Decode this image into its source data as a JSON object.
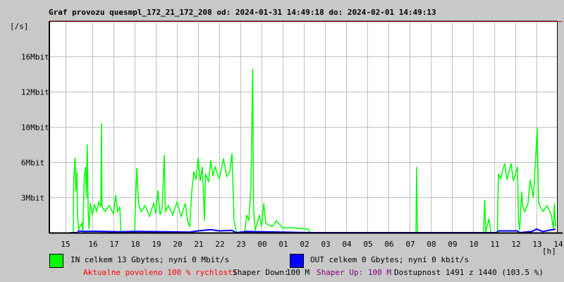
{
  "title": "Graf provozu quesmpl_172_21_172_208 od: 2024-01-31 14:49:18 do: 2024-02-01 14:49:13",
  "chart_data": {
    "type": "line",
    "title": "Graf provozu quesmpl_172_21_172_208 od: 2024-01-31 14:49:18 do: 2024-02-01 14:49:13",
    "ylabel": "[/s]",
    "xlabel": "[h]",
    "y_ticks": [
      {
        "v": 3,
        "label": "3Mbit"
      },
      {
        "v": 6,
        "label": "6Mbit"
      },
      {
        "v": 10,
        "label": "10Mbit"
      },
      {
        "v": 12,
        "label": "12Mbit"
      },
      {
        "v": 16,
        "label": "16Mbit"
      }
    ],
    "x_ticks": [
      {
        "h": 14.73,
        "label": "15"
      },
      {
        "h": 16,
        "label": "16"
      },
      {
        "h": 17,
        "label": "17"
      },
      {
        "h": 18,
        "label": "18"
      },
      {
        "h": 19,
        "label": "19"
      },
      {
        "h": 20,
        "label": "20"
      },
      {
        "h": 21,
        "label": "21"
      },
      {
        "h": 22,
        "label": "22"
      },
      {
        "h": 23,
        "label": "23"
      },
      {
        "h": 24,
        "label": "00"
      },
      {
        "h": 25,
        "label": "01"
      },
      {
        "h": 26,
        "label": "02"
      },
      {
        "h": 27,
        "label": "03"
      },
      {
        "h": 28,
        "label": "04"
      },
      {
        "h": 29,
        "label": "05"
      },
      {
        "h": 30,
        "label": "06"
      },
      {
        "h": 31,
        "label": "07"
      },
      {
        "h": 32,
        "label": "08"
      },
      {
        "h": 33,
        "label": "09"
      },
      {
        "h": 34,
        "label": "10"
      },
      {
        "h": 35,
        "label": "11"
      },
      {
        "h": 36,
        "label": "12"
      },
      {
        "h": 37,
        "label": "13"
      },
      {
        "h": 38,
        "label": "14"
      }
    ],
    "grid": true,
    "series": [
      {
        "name": "IN",
        "color": "#00ff00",
        "points": [
          [
            14.95,
            0
          ],
          [
            15.1,
            0
          ],
          [
            15.12,
            4.5
          ],
          [
            15.18,
            6.5
          ],
          [
            15.22,
            3.5
          ],
          [
            15.27,
            5.2
          ],
          [
            15.3,
            1.5
          ],
          [
            15.35,
            0.3
          ],
          [
            15.5,
            0.8
          ],
          [
            15.55,
            0.2
          ],
          [
            15.62,
            4.8
          ],
          [
            15.68,
            5.6
          ],
          [
            15.72,
            3
          ],
          [
            15.76,
            8
          ],
          [
            15.8,
            2
          ],
          [
            15.84,
            0.3
          ],
          [
            15.9,
            2.5
          ],
          [
            16.0,
            1.5
          ],
          [
            16.1,
            2.4
          ],
          [
            16.2,
            1.8
          ],
          [
            16.3,
            2.6
          ],
          [
            16.4,
            2.2
          ],
          [
            16.43,
            10.2
          ],
          [
            16.46,
            2.2
          ],
          [
            16.6,
            1.8
          ],
          [
            16.8,
            2.3
          ],
          [
            17.0,
            1.6
          ],
          [
            17.1,
            3.2
          ],
          [
            17.2,
            1.8
          ],
          [
            17.3,
            2.2
          ],
          [
            17.35,
            0
          ],
          [
            18.0,
            0
          ],
          [
            18.05,
            3
          ],
          [
            18.1,
            5.5
          ],
          [
            18.18,
            2.5
          ],
          [
            18.3,
            1.8
          ],
          [
            18.5,
            2.3
          ],
          [
            18.7,
            1.4
          ],
          [
            18.9,
            2.5
          ],
          [
            19.0,
            1.6
          ],
          [
            19.1,
            3.6
          ],
          [
            19.2,
            1.5
          ],
          [
            19.3,
            2.1
          ],
          [
            19.4,
            6.8
          ],
          [
            19.45,
            1.8
          ],
          [
            19.6,
            2.3
          ],
          [
            19.8,
            1.5
          ],
          [
            20.0,
            2.6
          ],
          [
            20.2,
            1.4
          ],
          [
            20.4,
            2.5
          ],
          [
            20.5,
            1.0
          ],
          [
            20.6,
            0.5
          ],
          [
            20.7,
            3.5
          ],
          [
            20.8,
            5.2
          ],
          [
            20.9,
            4.5
          ],
          [
            21.0,
            6.5
          ],
          [
            21.1,
            4.4
          ],
          [
            21.2,
            5.6
          ],
          [
            21.3,
            1.0
          ],
          [
            21.35,
            5.0
          ],
          [
            21.5,
            4.3
          ],
          [
            21.6,
            6.2
          ],
          [
            21.7,
            4.8
          ],
          [
            21.8,
            5.6
          ],
          [
            22.0,
            4.6
          ],
          [
            22.2,
            6.4
          ],
          [
            22.35,
            4.8
          ],
          [
            22.5,
            5.2
          ],
          [
            22.6,
            7.0
          ],
          [
            22.7,
            1.0
          ],
          [
            22.8,
            0.2
          ],
          [
            22.85,
            0
          ],
          [
            23.2,
            0
          ],
          [
            23.3,
            1.5
          ],
          [
            23.4,
            1.0
          ],
          [
            23.5,
            4
          ],
          [
            23.58,
            14.6
          ],
          [
            23.62,
            2
          ],
          [
            23.7,
            0.2
          ],
          [
            23.9,
            1.5
          ],
          [
            24.0,
            0.5
          ],
          [
            24.1,
            2.5
          ],
          [
            24.2,
            0.8
          ],
          [
            24.5,
            0.5
          ],
          [
            24.7,
            1.0
          ],
          [
            25.0,
            0.4
          ],
          [
            25.5,
            0.4
          ],
          [
            26.2,
            0.3
          ],
          [
            26.3,
            0
          ],
          [
            31.3,
            0
          ],
          [
            31.33,
            5.6
          ],
          [
            31.37,
            0
          ],
          [
            34.5,
            0
          ],
          [
            34.55,
            2.8
          ],
          [
            34.6,
            0
          ],
          [
            34.75,
            1.2
          ],
          [
            34.85,
            0
          ],
          [
            35.15,
            0
          ],
          [
            35.2,
            5.0
          ],
          [
            35.3,
            4.6
          ],
          [
            35.4,
            5.3
          ],
          [
            35.5,
            5.9
          ],
          [
            35.6,
            4.5
          ],
          [
            35.7,
            5.2
          ],
          [
            35.8,
            5.9
          ],
          [
            35.9,
            4.4
          ],
          [
            36.0,
            5.0
          ],
          [
            36.1,
            5.6
          ],
          [
            36.15,
            1.0
          ],
          [
            36.2,
            0.2
          ],
          [
            36.3,
            3.5
          ],
          [
            36.35,
            2.2
          ],
          [
            36.45,
            1.8
          ],
          [
            36.6,
            2.5
          ],
          [
            36.7,
            4.5
          ],
          [
            36.85,
            3.0
          ],
          [
            36.95,
            6
          ],
          [
            37.03,
            9.9
          ],
          [
            37.1,
            2.5
          ],
          [
            37.3,
            1.8
          ],
          [
            37.5,
            2.3
          ],
          [
            37.7,
            1.5
          ],
          [
            37.8,
            0.3
          ],
          [
            37.85,
            2.5
          ],
          [
            37.9,
            0.5
          ]
        ]
      },
      {
        "name": "OUT",
        "color": "#0000ff",
        "points": [
          [
            14.95,
            0
          ],
          [
            15.3,
            0
          ],
          [
            15.35,
            0.15
          ],
          [
            15.6,
            0.1
          ],
          [
            16.0,
            0.12
          ],
          [
            16.5,
            0.1
          ],
          [
            17.3,
            0.08
          ],
          [
            18.0,
            0.1
          ],
          [
            19.5,
            0.08
          ],
          [
            20.6,
            0.05
          ],
          [
            21.0,
            0.15
          ],
          [
            21.6,
            0.25
          ],
          [
            22.0,
            0.15
          ],
          [
            22.6,
            0.2
          ],
          [
            22.8,
            0
          ],
          [
            23.3,
            0.1
          ],
          [
            24.0,
            0.08
          ],
          [
            26.3,
            0
          ],
          [
            35.1,
            0
          ],
          [
            35.2,
            0.15
          ],
          [
            36.1,
            0.15
          ],
          [
            36.2,
            0
          ],
          [
            36.8,
            0.1
          ],
          [
            37.0,
            0.3
          ],
          [
            37.3,
            0.1
          ],
          [
            37.9,
            0.3
          ]
        ]
      }
    ]
  },
  "legend": {
    "in_text": "IN celkem 13 Gbytes; nyní 0 Mbit/s",
    "out_text": "OUT celkem 0 Gbytes; nyní 0 kbit/s",
    "in_color": "#00ff00",
    "out_color": "#0000ff"
  },
  "footer": {
    "allowed": "Aktualne povoleno 100 % rychlosti",
    "shaper_down_label": "Shaper Down:",
    "shaper_down_value": "100 M",
    "shaper_up": "Shaper Up: 100 M",
    "availability": "Dostupnost 1491 z 1440 (103.5 %)"
  }
}
